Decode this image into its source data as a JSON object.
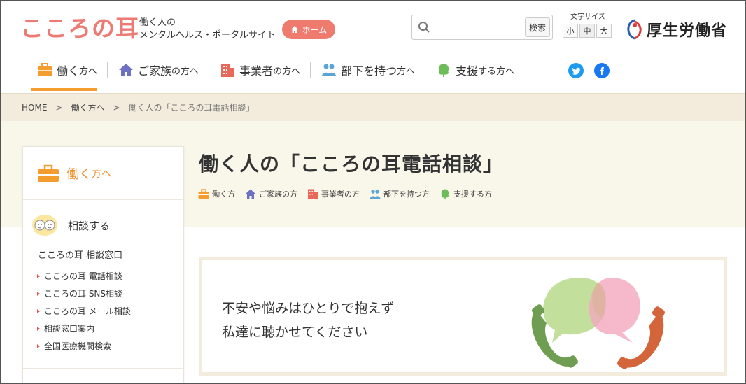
{
  "header": {
    "logo": "こころの耳",
    "tagline_1": "働く人の",
    "tagline_2": "メンタルヘルス・ポータルサイト",
    "home_label": "ホーム",
    "search_placeholder": "",
    "search_button": "検索",
    "font_size_label": "文字サイズ",
    "font_sizes": [
      "小",
      "中",
      "大"
    ],
    "ministry": "厚生労働省"
  },
  "gnav": [
    {
      "main": "働く",
      "suffix": "方へ",
      "icon": "briefcase-icon",
      "color": "#f59c2e"
    },
    {
      "main": "ご家族",
      "suffix": "の方へ",
      "icon": "house-icon",
      "color": "#6c71c4"
    },
    {
      "main": "事業者",
      "suffix": "の方へ",
      "icon": "building-icon",
      "color": "#e8685a"
    },
    {
      "main": "部下を持つ",
      "suffix": "方へ",
      "icon": "people-icon",
      "color": "#5aa5d6"
    },
    {
      "main": "支援",
      "suffix": "する方へ",
      "icon": "tree-icon",
      "color": "#6cbd5a"
    }
  ],
  "breadcrumb": {
    "home": "HOME",
    "sep": ">",
    "level1": "働く方へ",
    "current": "働く人の「こころの耳電話相談」"
  },
  "sidebar": {
    "head_main": "働く",
    "head_suffix": "方へ",
    "category": "相談する",
    "subheading": "こころの耳 相談窓口",
    "items": [
      "こころの耳 電話相談",
      "こころの耳 SNS相談",
      "こころの耳 メール相談",
      "相談窓口案内",
      "全国医療機関検索"
    ]
  },
  "page": {
    "title": "働く人の「こころの耳電話相談」",
    "tags": [
      "働く方",
      "ご家族の方",
      "事業者の方",
      "部下を持つ方",
      "支援する方"
    ],
    "card_line1": "不安や悩みはひとりで抱えず",
    "card_line2": "私達に聴かせてください"
  },
  "colors": {
    "brand": "#ee7a74",
    "accent": "#f59c2e",
    "breadcrumb_bg": "#f3ecdc"
  }
}
